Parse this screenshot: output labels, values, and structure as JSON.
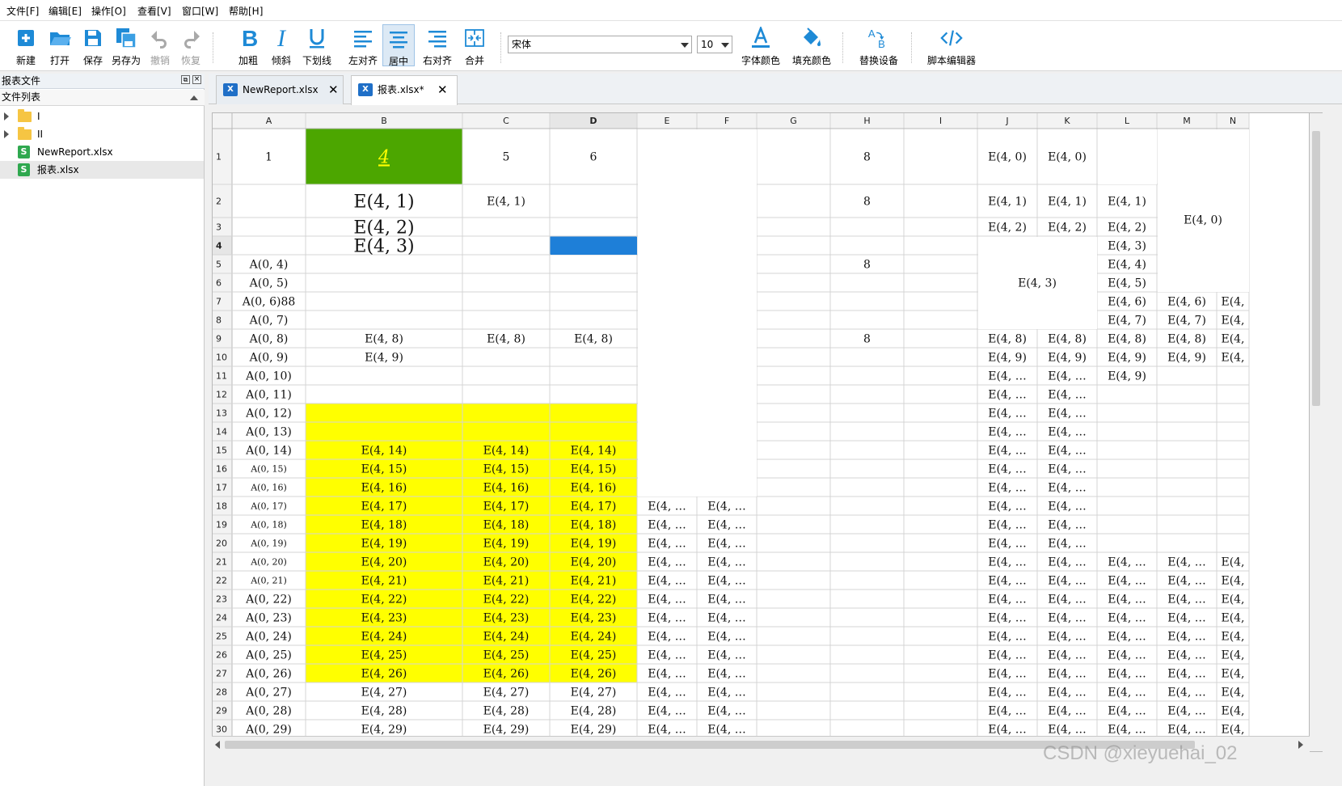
{
  "menu": [
    "文件[F]",
    "编辑[E]",
    "操作[O]",
    "查看[V]",
    "窗口[W]",
    "帮助[H]"
  ],
  "toolbar": {
    "new": "新建",
    "open": "打开",
    "save": "保存",
    "save_as": "另存为",
    "undo": "撤销",
    "redo": "恢复",
    "bold": "加粗",
    "italic": "倾斜",
    "underline": "下划线",
    "align_left": "左对齐",
    "align_center": "居中",
    "align_right": "右对齐",
    "merge": "合并",
    "font_name": "宋体",
    "font_size": "10",
    "font_color": "字体颜色",
    "fill_color": "填充颜色",
    "replace_device": "替换设备",
    "script_editor": "脚本编辑器"
  },
  "left_panel": {
    "title": "报表文件",
    "subtitle": "文件列表",
    "tree": [
      {
        "label": "I",
        "type": "folder"
      },
      {
        "label": "II",
        "type": "folder"
      },
      {
        "label": "NewReport.xlsx",
        "type": "file"
      },
      {
        "label": "报表.xlsx",
        "type": "file",
        "selected": true
      }
    ]
  },
  "tabs": [
    {
      "label": "NewReport.xlsx",
      "active": false
    },
    {
      "label": "报表.xlsx*",
      "active": true
    }
  ],
  "grid": {
    "columns": [
      "A",
      "B",
      "C",
      "D",
      "E",
      "F",
      "G",
      "H",
      "I",
      "J",
      "K",
      "L",
      "M",
      "N"
    ],
    "selected_column": "D",
    "selected_row": 4,
    "rows": [
      1,
      2,
      3,
      4,
      5,
      6,
      7,
      8,
      9,
      10,
      11,
      12,
      13,
      14,
      15,
      16,
      17,
      18,
      19,
      20,
      21,
      22,
      23,
      24,
      25,
      26,
      27,
      28,
      29,
      30
    ],
    "colors": {
      "green": "#4ca600",
      "blue": "#1e7fd8",
      "yellow": "#ffff00",
      "italic_text": "#ffff00"
    },
    "cells": [
      {
        "r": 1,
        "c": "A",
        "v": "1"
      },
      {
        "r": 1,
        "c": "B",
        "v": "4",
        "style": "green-italic"
      },
      {
        "r": 1,
        "c": "C",
        "v": "5"
      },
      {
        "r": 1,
        "c": "D",
        "v": "6"
      },
      {
        "r": 1,
        "c": "H",
        "v": "8"
      },
      {
        "r": 1,
        "c": "J",
        "v": "E(4, 0)"
      },
      {
        "r": 1,
        "c": "K",
        "v": "E(4, 0)"
      },
      {
        "r": 2,
        "c": "B",
        "v": "E(4, 1)",
        "style": "big"
      },
      {
        "r": 2,
        "c": "C",
        "v": "E(4, 1)"
      },
      {
        "r": 2,
        "c": "H",
        "v": "8"
      },
      {
        "r": 2,
        "c": "J",
        "v": "E(4, 1)"
      },
      {
        "r": 2,
        "c": "K",
        "v": "E(4, 1)"
      },
      {
        "r": 2,
        "c": "L",
        "v": "E(4, 1)"
      },
      {
        "r": 2,
        "c": "M",
        "v": "E(4, 0)",
        "span": "M2:N4"
      },
      {
        "r": 3,
        "c": "B",
        "v": "E(4, 2)",
        "style": "big"
      },
      {
        "r": 3,
        "c": "J",
        "v": "E(4, 2)"
      },
      {
        "r": 3,
        "c": "K",
        "v": "E(4, 2)"
      },
      {
        "r": 3,
        "c": "L",
        "v": "E(4, 2)"
      },
      {
        "r": 4,
        "c": "B",
        "v": "E(4, 3)",
        "style": "big"
      },
      {
        "r": 4,
        "c": "L",
        "v": "E(4, 3)"
      },
      {
        "r": 5,
        "c": "A",
        "v": "A(0, 4)"
      },
      {
        "r": 5,
        "c": "H",
        "v": "8"
      },
      {
        "r": 5,
        "c": "J",
        "v": "E(4, 3)",
        "span": "J4:K8"
      },
      {
        "r": 5,
        "c": "L",
        "v": "E(4, 4)"
      },
      {
        "r": 6,
        "c": "A",
        "v": "A(0, 5)"
      },
      {
        "r": 6,
        "c": "L",
        "v": "E(4, 5)"
      },
      {
        "r": 7,
        "c": "A",
        "v": "A(0, 6)88"
      },
      {
        "r": 7,
        "c": "L",
        "v": "E(4, 6)"
      },
      {
        "r": 7,
        "c": "M",
        "v": "E(4, 6)"
      },
      {
        "r": 7,
        "c": "N",
        "v": "E(4,"
      },
      {
        "r": 8,
        "c": "A",
        "v": "A(0, 7)"
      },
      {
        "r": 8,
        "c": "L",
        "v": "E(4, 7)"
      },
      {
        "r": 8,
        "c": "M",
        "v": "E(4, 7)"
      },
      {
        "r": 8,
        "c": "N",
        "v": "E(4,"
      },
      {
        "r": 9,
        "c": "A",
        "v": "A(0, 8)"
      },
      {
        "r": 9,
        "c": "B",
        "v": "E(4, 8)"
      },
      {
        "r": 9,
        "c": "C",
        "v": "E(4, 8)"
      },
      {
        "r": 9,
        "c": "D",
        "v": "E(4, 8)"
      },
      {
        "r": 9,
        "c": "H",
        "v": "8"
      },
      {
        "r": 9,
        "c": "J",
        "v": "E(4, 8)"
      },
      {
        "r": 9,
        "c": "K",
        "v": "E(4, 8)"
      },
      {
        "r": 9,
        "c": "L",
        "v": "E(4, 8)"
      },
      {
        "r": 9,
        "c": "M",
        "v": "E(4, 8)"
      },
      {
        "r": 9,
        "c": "N",
        "v": "E(4,"
      },
      {
        "r": 10,
        "c": "A",
        "v": "A(0, 9)"
      },
      {
        "r": 10,
        "c": "B",
        "v": "E(4, 9)"
      },
      {
        "r": 10,
        "c": "J",
        "v": "E(4, 9)"
      },
      {
        "r": 10,
        "c": "K",
        "v": "E(4, 9)"
      },
      {
        "r": 10,
        "c": "L",
        "v": "E(4, 9)"
      },
      {
        "r": 10,
        "c": "M",
        "v": "E(4, 9)"
      },
      {
        "r": 10,
        "c": "N",
        "v": "E(4,"
      },
      {
        "r": 11,
        "c": "A",
        "v": "A(0, 10)"
      },
      {
        "r": 11,
        "c": "J",
        "v": "E(4, …"
      },
      {
        "r": 11,
        "c": "K",
        "v": "E(4, …"
      },
      {
        "r": 11,
        "c": "L",
        "v": "E(4, 9)"
      },
      {
        "r": 12,
        "c": "A",
        "v": "A(0, 11)"
      },
      {
        "r": 12,
        "c": "J",
        "v": "E(4, …"
      },
      {
        "r": 12,
        "c": "K",
        "v": "E(4, …"
      },
      {
        "r": 13,
        "c": "A",
        "v": "A(0, 12)"
      },
      {
        "r": 13,
        "c": "J",
        "v": "E(4, …"
      },
      {
        "r": 13,
        "c": "K",
        "v": "E(4, …"
      },
      {
        "r": 14,
        "c": "A",
        "v": "A(0, 13)"
      },
      {
        "r": 14,
        "c": "J",
        "v": "E(4, …"
      },
      {
        "r": 14,
        "c": "K",
        "v": "E(4, …"
      },
      {
        "r": 15,
        "c": "A",
        "v": "A(0, 14)"
      },
      {
        "r": 15,
        "c": "B",
        "v": "E(4, 14)"
      },
      {
        "r": 15,
        "c": "C",
        "v": "E(4, 14)"
      },
      {
        "r": 15,
        "c": "D",
        "v": "E(4, 14)"
      },
      {
        "r": 15,
        "c": "J",
        "v": "E(4, …"
      },
      {
        "r": 15,
        "c": "K",
        "v": "E(4, …"
      },
      {
        "r": 16,
        "c": "A",
        "v": "A(0, 15)",
        "style": "small"
      },
      {
        "r": 16,
        "c": "B",
        "v": "E(4, 15)"
      },
      {
        "r": 16,
        "c": "C",
        "v": "E(4, 15)"
      },
      {
        "r": 16,
        "c": "D",
        "v": "E(4, 15)"
      },
      {
        "r": 16,
        "c": "J",
        "v": "E(4, …"
      },
      {
        "r": 16,
        "c": "K",
        "v": "E(4, …"
      },
      {
        "r": 17,
        "c": "A",
        "v": "A(0, 16)",
        "style": "small"
      },
      {
        "r": 17,
        "c": "B",
        "v": "E(4, 16)"
      },
      {
        "r": 17,
        "c": "C",
        "v": "E(4, 16)"
      },
      {
        "r": 17,
        "c": "D",
        "v": "E(4, 16)"
      },
      {
        "r": 17,
        "c": "J",
        "v": "E(4, …"
      },
      {
        "r": 17,
        "c": "K",
        "v": "E(4, …"
      },
      {
        "r": 18,
        "c": "A",
        "v": "A(0, 17)",
        "style": "small"
      },
      {
        "r": 18,
        "c": "B",
        "v": "E(4, 17)"
      },
      {
        "r": 18,
        "c": "C",
        "v": "E(4, 17)"
      },
      {
        "r": 18,
        "c": "D",
        "v": "E(4, 17)"
      },
      {
        "r": 18,
        "c": "E",
        "v": "E(4, …"
      },
      {
        "r": 18,
        "c": "F",
        "v": "E(4, …"
      },
      {
        "r": 18,
        "c": "J",
        "v": "E(4, …"
      },
      {
        "r": 18,
        "c": "K",
        "v": "E(4, …"
      },
      {
        "r": 19,
        "c": "A",
        "v": "A(0, 18)",
        "style": "small"
      },
      {
        "r": 19,
        "c": "B",
        "v": "E(4, 18)"
      },
      {
        "r": 19,
        "c": "C",
        "v": "E(4, 18)"
      },
      {
        "r": 19,
        "c": "D",
        "v": "E(4, 18)"
      },
      {
        "r": 19,
        "c": "E",
        "v": "E(4, …"
      },
      {
        "r": 19,
        "c": "F",
        "v": "E(4, …"
      },
      {
        "r": 19,
        "c": "J",
        "v": "E(4, …"
      },
      {
        "r": 19,
        "c": "K",
        "v": "E(4, …"
      },
      {
        "r": 20,
        "c": "A",
        "v": "A(0, 19)",
        "style": "small"
      },
      {
        "r": 20,
        "c": "B",
        "v": "E(4, 19)"
      },
      {
        "r": 20,
        "c": "C",
        "v": "E(4, 19)"
      },
      {
        "r": 20,
        "c": "D",
        "v": "E(4, 19)"
      },
      {
        "r": 20,
        "c": "E",
        "v": "E(4, …"
      },
      {
        "r": 20,
        "c": "F",
        "v": "E(4, …"
      },
      {
        "r": 20,
        "c": "J",
        "v": "E(4, …"
      },
      {
        "r": 20,
        "c": "K",
        "v": "E(4, …"
      },
      {
        "r": 21,
        "c": "A",
        "v": "A(0, 20)",
        "style": "small"
      },
      {
        "r": 21,
        "c": "B",
        "v": "E(4, 20)"
      },
      {
        "r": 21,
        "c": "C",
        "v": "E(4, 20)"
      },
      {
        "r": 21,
        "c": "D",
        "v": "E(4, 20)"
      },
      {
        "r": 21,
        "c": "E",
        "v": "E(4, …"
      },
      {
        "r": 21,
        "c": "F",
        "v": "E(4, …"
      },
      {
        "r": 21,
        "c": "J",
        "v": "E(4, …"
      },
      {
        "r": 21,
        "c": "K",
        "v": "E(4, …"
      },
      {
        "r": 21,
        "c": "L",
        "v": "E(4, …"
      },
      {
        "r": 21,
        "c": "M",
        "v": "E(4, …"
      },
      {
        "r": 21,
        "c": "N",
        "v": "E(4,"
      },
      {
        "r": 22,
        "c": "A",
        "v": "A(0, 21)",
        "style": "small"
      },
      {
        "r": 22,
        "c": "B",
        "v": "E(4, 21)"
      },
      {
        "r": 22,
        "c": "C",
        "v": "E(4, 21)"
      },
      {
        "r": 22,
        "c": "D",
        "v": "E(4, 21)"
      },
      {
        "r": 22,
        "c": "E",
        "v": "E(4, …"
      },
      {
        "r": 22,
        "c": "F",
        "v": "E(4, …"
      },
      {
        "r": 22,
        "c": "J",
        "v": "E(4, …"
      },
      {
        "r": 22,
        "c": "K",
        "v": "E(4, …"
      },
      {
        "r": 22,
        "c": "L",
        "v": "E(4, …"
      },
      {
        "r": 22,
        "c": "M",
        "v": "E(4, …"
      },
      {
        "r": 22,
        "c": "N",
        "v": "E(4,"
      },
      {
        "r": 23,
        "c": "A",
        "v": "A(0, 22)"
      },
      {
        "r": 23,
        "c": "B",
        "v": "E(4, 22)"
      },
      {
        "r": 23,
        "c": "C",
        "v": "E(4, 22)"
      },
      {
        "r": 23,
        "c": "D",
        "v": "E(4, 22)"
      },
      {
        "r": 23,
        "c": "E",
        "v": "E(4, …"
      },
      {
        "r": 23,
        "c": "F",
        "v": "E(4, …"
      },
      {
        "r": 23,
        "c": "J",
        "v": "E(4, …"
      },
      {
        "r": 23,
        "c": "K",
        "v": "E(4, …"
      },
      {
        "r": 23,
        "c": "L",
        "v": "E(4, …"
      },
      {
        "r": 23,
        "c": "M",
        "v": "E(4, …"
      },
      {
        "r": 23,
        "c": "N",
        "v": "E(4,"
      },
      {
        "r": 24,
        "c": "A",
        "v": "A(0, 23)"
      },
      {
        "r": 24,
        "c": "B",
        "v": "E(4, 23)"
      },
      {
        "r": 24,
        "c": "C",
        "v": "E(4, 23)"
      },
      {
        "r": 24,
        "c": "D",
        "v": "E(4, 23)"
      },
      {
        "r": 24,
        "c": "E",
        "v": "E(4, …"
      },
      {
        "r": 24,
        "c": "F",
        "v": "E(4, …"
      },
      {
        "r": 24,
        "c": "J",
        "v": "E(4, …"
      },
      {
        "r": 24,
        "c": "K",
        "v": "E(4, …"
      },
      {
        "r": 24,
        "c": "L",
        "v": "E(4, …"
      },
      {
        "r": 24,
        "c": "M",
        "v": "E(4, …"
      },
      {
        "r": 24,
        "c": "N",
        "v": "E(4,"
      },
      {
        "r": 25,
        "c": "A",
        "v": "A(0, 24)"
      },
      {
        "r": 25,
        "c": "B",
        "v": "E(4, 24)"
      },
      {
        "r": 25,
        "c": "C",
        "v": "E(4, 24)"
      },
      {
        "r": 25,
        "c": "D",
        "v": "E(4, 24)"
      },
      {
        "r": 25,
        "c": "E",
        "v": "E(4, …"
      },
      {
        "r": 25,
        "c": "F",
        "v": "E(4, …"
      },
      {
        "r": 25,
        "c": "J",
        "v": "E(4, …"
      },
      {
        "r": 25,
        "c": "K",
        "v": "E(4, …"
      },
      {
        "r": 25,
        "c": "L",
        "v": "E(4, …"
      },
      {
        "r": 25,
        "c": "M",
        "v": "E(4, …"
      },
      {
        "r": 25,
        "c": "N",
        "v": "E(4,"
      },
      {
        "r": 26,
        "c": "A",
        "v": "A(0, 25)"
      },
      {
        "r": 26,
        "c": "B",
        "v": "E(4, 25)"
      },
      {
        "r": 26,
        "c": "C",
        "v": "E(4, 25)"
      },
      {
        "r": 26,
        "c": "D",
        "v": "E(4, 25)"
      },
      {
        "r": 26,
        "c": "E",
        "v": "E(4, …"
      },
      {
        "r": 26,
        "c": "F",
        "v": "E(4, …"
      },
      {
        "r": 26,
        "c": "J",
        "v": "E(4, …"
      },
      {
        "r": 26,
        "c": "K",
        "v": "E(4, …"
      },
      {
        "r": 26,
        "c": "L",
        "v": "E(4, …"
      },
      {
        "r": 26,
        "c": "M",
        "v": "E(4, …"
      },
      {
        "r": 26,
        "c": "N",
        "v": "E(4,"
      },
      {
        "r": 27,
        "c": "A",
        "v": "A(0, 26)"
      },
      {
        "r": 27,
        "c": "B",
        "v": "E(4, 26)"
      },
      {
        "r": 27,
        "c": "C",
        "v": "E(4, 26)"
      },
      {
        "r": 27,
        "c": "D",
        "v": "E(4, 26)"
      },
      {
        "r": 27,
        "c": "E",
        "v": "E(4, …"
      },
      {
        "r": 27,
        "c": "F",
        "v": "E(4, …"
      },
      {
        "r": 27,
        "c": "J",
        "v": "E(4, …"
      },
      {
        "r": 27,
        "c": "K",
        "v": "E(4, …"
      },
      {
        "r": 27,
        "c": "L",
        "v": "E(4, …"
      },
      {
        "r": 27,
        "c": "M",
        "v": "E(4, …"
      },
      {
        "r": 27,
        "c": "N",
        "v": "E(4,"
      },
      {
        "r": 28,
        "c": "A",
        "v": "A(0, 27)"
      },
      {
        "r": 28,
        "c": "B",
        "v": "E(4, 27)"
      },
      {
        "r": 28,
        "c": "C",
        "v": "E(4, 27)"
      },
      {
        "r": 28,
        "c": "D",
        "v": "E(4, 27)"
      },
      {
        "r": 28,
        "c": "E",
        "v": "E(4, …"
      },
      {
        "r": 28,
        "c": "F",
        "v": "E(4, …"
      },
      {
        "r": 28,
        "c": "J",
        "v": "E(4, …"
      },
      {
        "r": 28,
        "c": "K",
        "v": "E(4, …"
      },
      {
        "r": 28,
        "c": "L",
        "v": "E(4, …"
      },
      {
        "r": 28,
        "c": "M",
        "v": "E(4, …"
      },
      {
        "r": 28,
        "c": "N",
        "v": "E(4,"
      },
      {
        "r": 29,
        "c": "A",
        "v": "A(0, 28)"
      },
      {
        "r": 29,
        "c": "B",
        "v": "E(4, 28)"
      },
      {
        "r": 29,
        "c": "C",
        "v": "E(4, 28)"
      },
      {
        "r": 29,
        "c": "D",
        "v": "E(4, 28)"
      },
      {
        "r": 29,
        "c": "E",
        "v": "E(4, …"
      },
      {
        "r": 29,
        "c": "F",
        "v": "E(4, …"
      },
      {
        "r": 29,
        "c": "J",
        "v": "E(4, …"
      },
      {
        "r": 29,
        "c": "K",
        "v": "E(4, …"
      },
      {
        "r": 29,
        "c": "L",
        "v": "E(4, …"
      },
      {
        "r": 29,
        "c": "M",
        "v": "E(4, …"
      },
      {
        "r": 29,
        "c": "N",
        "v": "E(4,"
      },
      {
        "r": 30,
        "c": "A",
        "v": "A(0, 29)"
      },
      {
        "r": 30,
        "c": "B",
        "v": "E(4, 29)"
      },
      {
        "r": 30,
        "c": "C",
        "v": "E(4, 29)"
      },
      {
        "r": 30,
        "c": "D",
        "v": "E(4, 29)"
      },
      {
        "r": 30,
        "c": "E",
        "v": "E(4, …"
      },
      {
        "r": 30,
        "c": "F",
        "v": "E(4, …"
      },
      {
        "r": 30,
        "c": "J",
        "v": "E(4, …"
      },
      {
        "r": 30,
        "c": "K",
        "v": "E(4, …"
      },
      {
        "r": 30,
        "c": "L",
        "v": "E(4, …"
      },
      {
        "r": 30,
        "c": "M",
        "v": "E(4, …"
      },
      {
        "r": 30,
        "c": "N",
        "v": "E(4,"
      }
    ]
  },
  "watermark": "CSDN @xieyuehai_02"
}
